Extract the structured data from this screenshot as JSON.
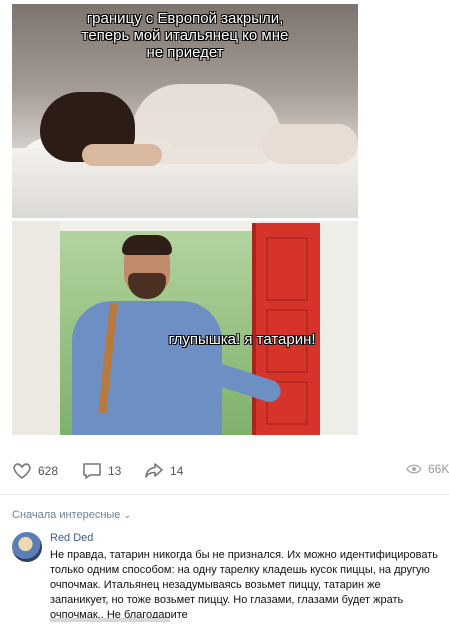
{
  "meme": {
    "top_caption": "границу с Европой закрыли,\nтеперь мой итальянец ко мне\nне приедет",
    "bottom_caption": "глупышка! я татарин!"
  },
  "actions": {
    "likes": "628",
    "comments": "13",
    "shares": "14",
    "views": "66K"
  },
  "comments_section": {
    "sort_label": "Сначала интересные",
    "author": "Red Ded",
    "text": "Не правда, татарин никогда бы не признался. Их можно идентифицировать только одним способом: на одну тарелку кладешь кусок пиццы, на другую очпочмак. Итальянец незадумываясь возьмет пиццу, татарин же запаникует, но тоже возьмет пиццу. Но глазами, глазами будет жрать очпочмак.. Не благодарите"
  }
}
